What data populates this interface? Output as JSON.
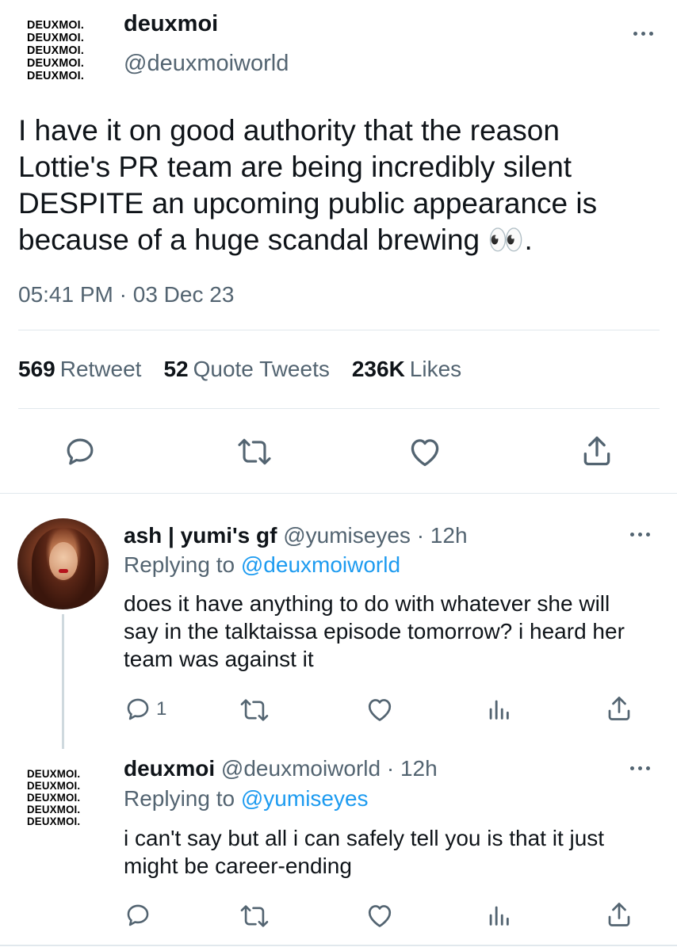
{
  "main_tweet": {
    "logo_lines": [
      "DEUXMOI.",
      "DEUXMOI.",
      "DEUXMOI.",
      "DEUXMOI.",
      "DEUXMOI."
    ],
    "display_name": "deuxmoi",
    "handle": "@deuxmoiworld",
    "text": "I have it on good authority that the reason Lottie's PR team are being incredibly silent DESPITE an upcoming public appearance is because of a huge scandal brewing 👀.",
    "time": "05:41 PM",
    "date": "03 Dec 23",
    "time_separator": "·",
    "stats": {
      "retweets_count": "569",
      "retweets_label": "Retweet",
      "quotes_count": "52",
      "quotes_label": "Quote Tweets",
      "likes_count": "236K",
      "likes_label": "Likes"
    }
  },
  "replies": [
    {
      "display_name": "ash | yumi's gf",
      "handle": "@yumiseyes",
      "separator": "·",
      "time": "12h",
      "replying_prefix": "Replying to",
      "replying_to": "@deuxmoiworld",
      "text": "does it have anything to do with whatever she will say in the talktaissa episode tomorrow? i heard her team was against it",
      "reply_count": "1"
    },
    {
      "logo_lines": [
        "DEUXMOI.",
        "DEUXMOI.",
        "DEUXMOI.",
        "DEUXMOI.",
        "DEUXMOI."
      ],
      "display_name": "deuxmoi",
      "handle": "@deuxmoiworld",
      "separator": "·",
      "time": "12h",
      "replying_prefix": "Replying to",
      "replying_to": "@yumiseyes",
      "text": "i can't say but all i can safely tell you is that it just might be career-ending",
      "reply_count": ""
    }
  ],
  "colors": {
    "text": "#0f1419",
    "muted": "#536471",
    "link": "#1d9bf0",
    "divider": "#e1e8ed"
  },
  "icons": [
    "reply-icon",
    "retweet-icon",
    "like-icon",
    "share-icon",
    "analytics-icon",
    "more-icon"
  ]
}
